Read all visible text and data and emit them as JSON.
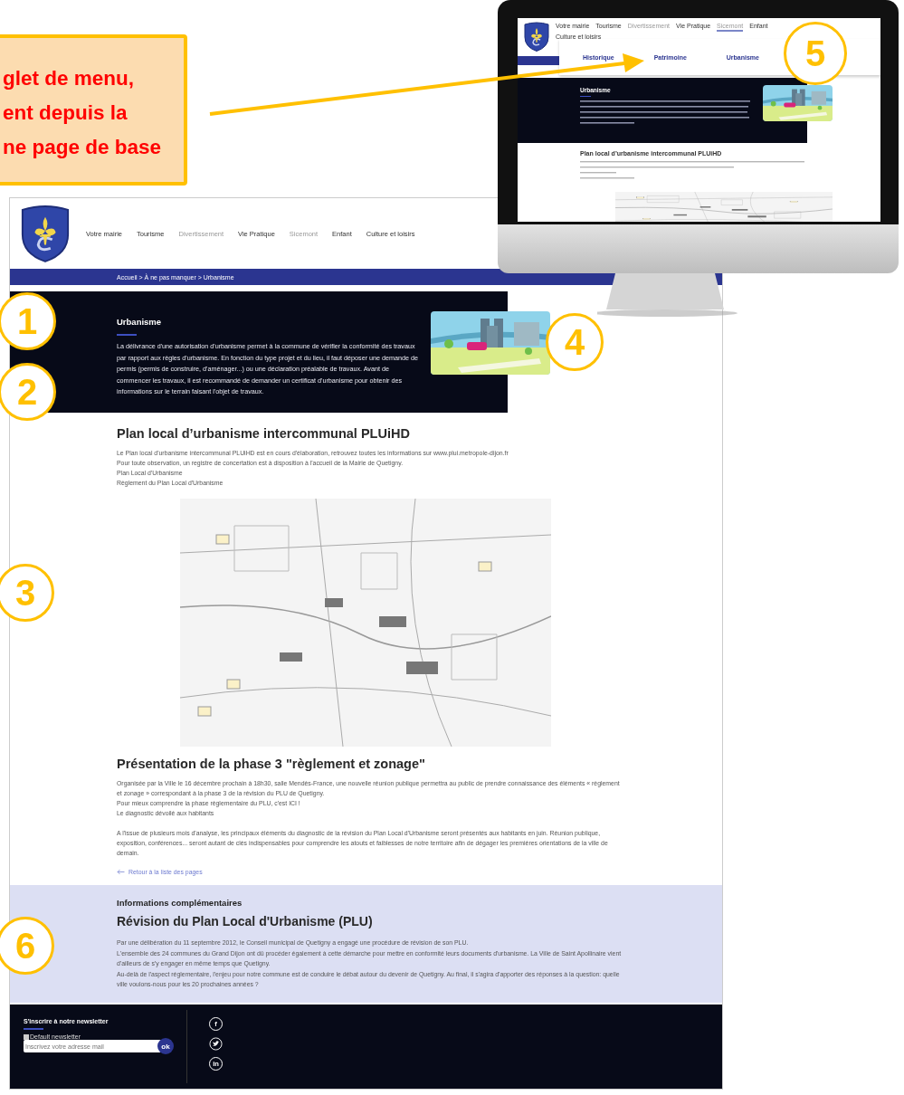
{
  "callout": {
    "lines": [
      "glet de menu,",
      "ent depuis la",
      "ne page de base"
    ]
  },
  "markers": [
    "1",
    "2",
    "3",
    "4",
    "5",
    "6"
  ],
  "monitor": {
    "nav": [
      {
        "label": "Votre mairie",
        "dimmed": false,
        "selected": false
      },
      {
        "label": "Tourisme",
        "dimmed": false,
        "selected": false
      },
      {
        "label": "Divertissement",
        "dimmed": true,
        "selected": false
      },
      {
        "label": "Vie Pratique",
        "dimmed": false,
        "selected": false
      },
      {
        "label": "Sicemont",
        "dimmed": true,
        "selected": true
      },
      {
        "label": "Enfant",
        "dimmed": false,
        "selected": false
      },
      {
        "label": "Culture et loisirs",
        "dimmed": false,
        "selected": false
      }
    ],
    "submenu": [
      "Historique",
      "Patrimoine",
      "Urbanisme"
    ],
    "hero": {
      "title": "Urbanisme"
    },
    "section": {
      "title": "Plan local d’urbanisme intercommunal PLUiHD"
    }
  },
  "page": {
    "nav": [
      {
        "label": "Votre mairie",
        "dimmed": false
      },
      {
        "label": "Tourisme",
        "dimmed": false
      },
      {
        "label": "Divertissement",
        "dimmed": true
      },
      {
        "label": "Vie Pratique",
        "dimmed": false
      },
      {
        "label": "Sicemont",
        "dimmed": true
      },
      {
        "label": "Enfant",
        "dimmed": false
      },
      {
        "label": "Culture et loisirs",
        "dimmed": false
      }
    ],
    "breadcrumb": "Accueil > À ne pas manquer > Urbanisme",
    "hero": {
      "title": "Urbanisme",
      "text": "La délivrance d'une autorisation d'urbanisme permet à la commune de vérifier la conformité des travaux par rapport aux règles d'urbanisme. En fonction du type projet et du lieu, il faut déposer une demande de permis (permis de construire, d'aménager...) ou une déclaration préalable de travaux. Avant de commencer les travaux, il est recommandé de demander un certificat d'urbanisme pour obtenir des informations sur le terrain faisant l'objet de travaux."
    },
    "plan": {
      "title": "Plan local d’urbanisme intercommunal PLUiHD",
      "lines": [
        "Le Plan local d'urbanisme intercommunal PLUiHD est en cours d'élaboration, retrouvez toutes les informations sur www.plui.metropole-dijon.fr",
        "Pour toute observation, un registre de concertation est à disposition à l'accueil de la Mairie de Quetigny.",
        "Plan Local d'Urbanisme",
        "Règlement du Plan Local d'Urbanisme"
      ]
    },
    "presentation": {
      "title": "Présentation de la phase 3 \"règlement et zonage\"",
      "lines": [
        "Organisée par la Ville le 16 décembre prochain à 18h30, salle Mendès-France, une nouvelle réunion publique permettra au public de prendre connaissance des éléments « règlement et zonage » correspondant à la phase 3 de la révision du PLU de Quetigny.",
        "Pour mieux comprendre la phase règlementaire du PLU, c'est ICI !",
        "Le diagnostic dévoilé aux habitants"
      ],
      "paragraph": "A l'issue de plusieurs mois d'analyse, les principaux éléments du diagnostic de la révision du Plan Local d'Urbanisme seront présentés aux habitants en juin. Réunion publique, exposition, conférences... seront autant de clés indispensables pour comprendre les atouts et faiblesses de notre territoire afin de dégager les premières orientations de la ville de demain."
    },
    "back_link": "Retour à la liste des pages",
    "info": {
      "kicker": "Informations complémentaires",
      "title": "Révision du Plan Local d'Urbanisme (PLU)",
      "lines": [
        "Par une délibération du 11 septembre 2012, le Conseil municipal de Quetigny a engagé une procédure de révision de son PLU.",
        "L'ensemble des 24 communes du Grand Dijon ont dû procéder également à cette démarche pour mettre en conformité leurs documents d'urbanisme. La Ville de Saint Apollinaire vient d'ailleurs de s'y engager en même temps que Quetigny.",
        "Au-delà de l'aspect réglementaire, l'enjeu pour notre commune est de conduire le débat autour du devenir de Quetigny. Au final, il s'agira d'apporter des réponses à la question: quelle ville voulons-nous pour les 20 prochaines années ?"
      ]
    },
    "footer": {
      "title": "S'inscrire à notre newsletter",
      "checkbox": {
        "label": "Default newsletter",
        "checked": false
      },
      "placeholder": "Inscrivez votre adresse mail",
      "submit": "ok",
      "social": [
        {
          "kind": "glyph",
          "glyph": "f"
        },
        {
          "kind": "bird"
        },
        {
          "kind": "glyph",
          "glyph": "in"
        }
      ]
    }
  }
}
